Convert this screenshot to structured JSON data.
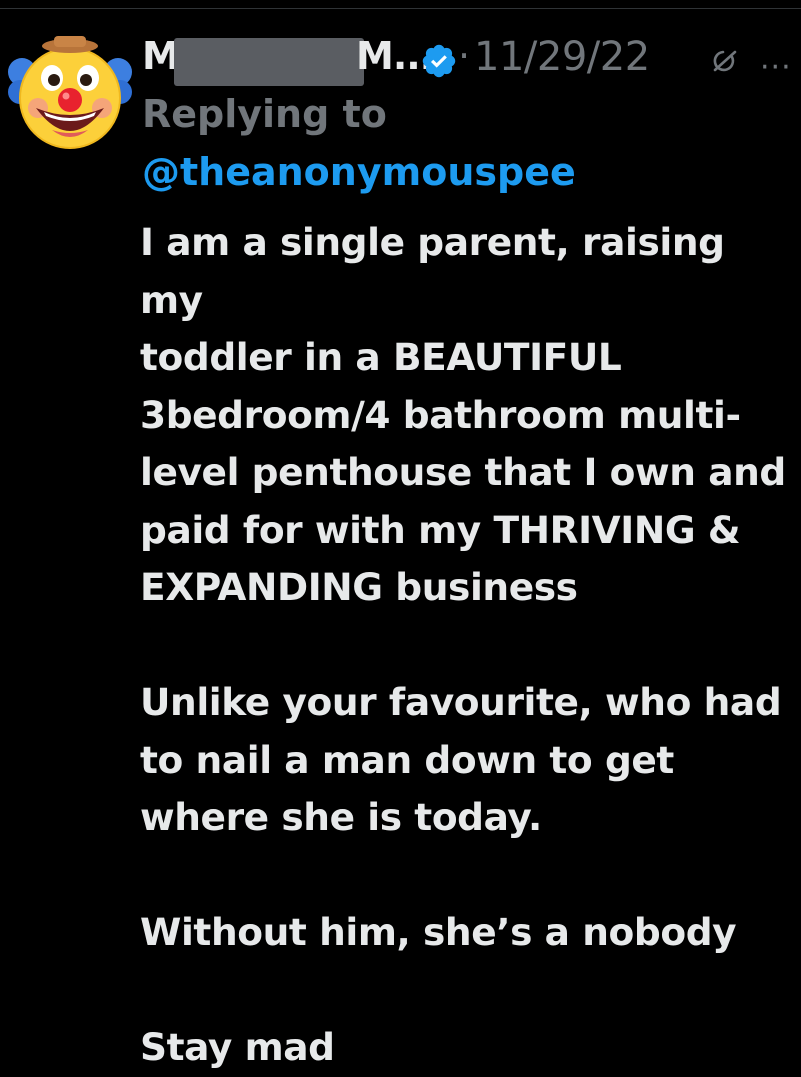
{
  "tweet": {
    "author": {
      "name_visible_start": "M",
      "name_visible_end": "M...",
      "verified": true,
      "avatar_icon": "clown-face-emoji-icon"
    },
    "separator": "·",
    "date": "11/29/22",
    "grok_icon": "grok-icon",
    "more_label": "···",
    "replying_to_label": "Replying to",
    "replying_to_handle": "@theanonymouspee",
    "body": [
      "I am a single parent, raising my\ntoddler in a BEAUTIFUL\n3bedroom/4 bathroom multi-\nlevel penthouse that I own and\npaid for with my THRIVING &\nEXPANDING business",
      "",
      "Unlike your favourite, who had\nto nail a man down to get\nwhere she is today.",
      "",
      "Without him, she’s a nobody",
      "",
      "Stay mad"
    ]
  },
  "colors": {
    "background": "#000000",
    "text_primary": "#e7e9ea",
    "text_secondary": "#71767b",
    "link": "#1d9bf0",
    "verified": "#1d9bf0"
  }
}
